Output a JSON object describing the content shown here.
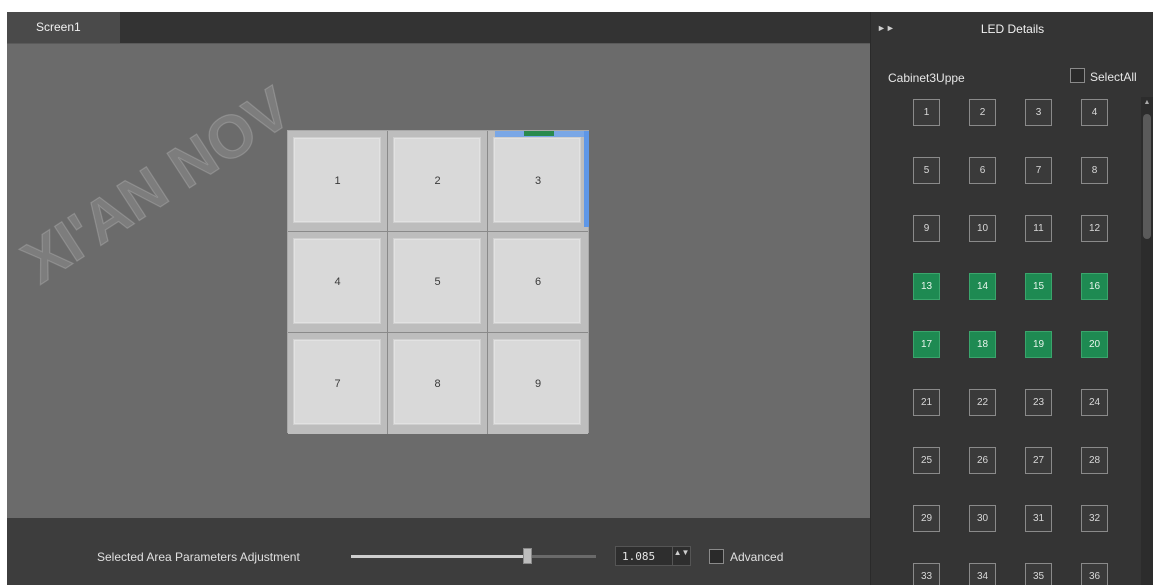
{
  "tabs": {
    "screen1": "Screen1"
  },
  "cabinets": [
    "1",
    "2",
    "3",
    "4",
    "5",
    "6",
    "7",
    "8",
    "9"
  ],
  "bottom_bar": {
    "adjust_label": "Selected Area Parameters Adjustment",
    "value": "1.085",
    "slider_level": 0.72,
    "advanced_label": "Advanced",
    "spin_arrows": "▲▼"
  },
  "led_panel": {
    "title": "LED Details",
    "cabinet_label": "Cabinet3Uppe",
    "select_all_label": "SelectAll",
    "leds": [
      "1",
      "2",
      "3",
      "4",
      "5",
      "6",
      "7",
      "8",
      "9",
      "10",
      "11",
      "12",
      "13",
      "14",
      "15",
      "16",
      "17",
      "18",
      "19",
      "20",
      "21",
      "22",
      "23",
      "24",
      "25",
      "26",
      "27",
      "28",
      "29",
      "30",
      "31",
      "32",
      "33",
      "34",
      "35",
      "36"
    ],
    "selected": [
      "13",
      "14",
      "15",
      "16",
      "17",
      "18",
      "19",
      "20"
    ]
  },
  "icons": {
    "expand": "double-chevron-right-icon",
    "scroll_up": "chevron-up-icon"
  },
  "colors": {
    "selected_led": "#1e8a52",
    "selection_frame": "#5e97e8",
    "canvas": "#6b6b6b"
  },
  "watermark": "XI'AN NOV"
}
